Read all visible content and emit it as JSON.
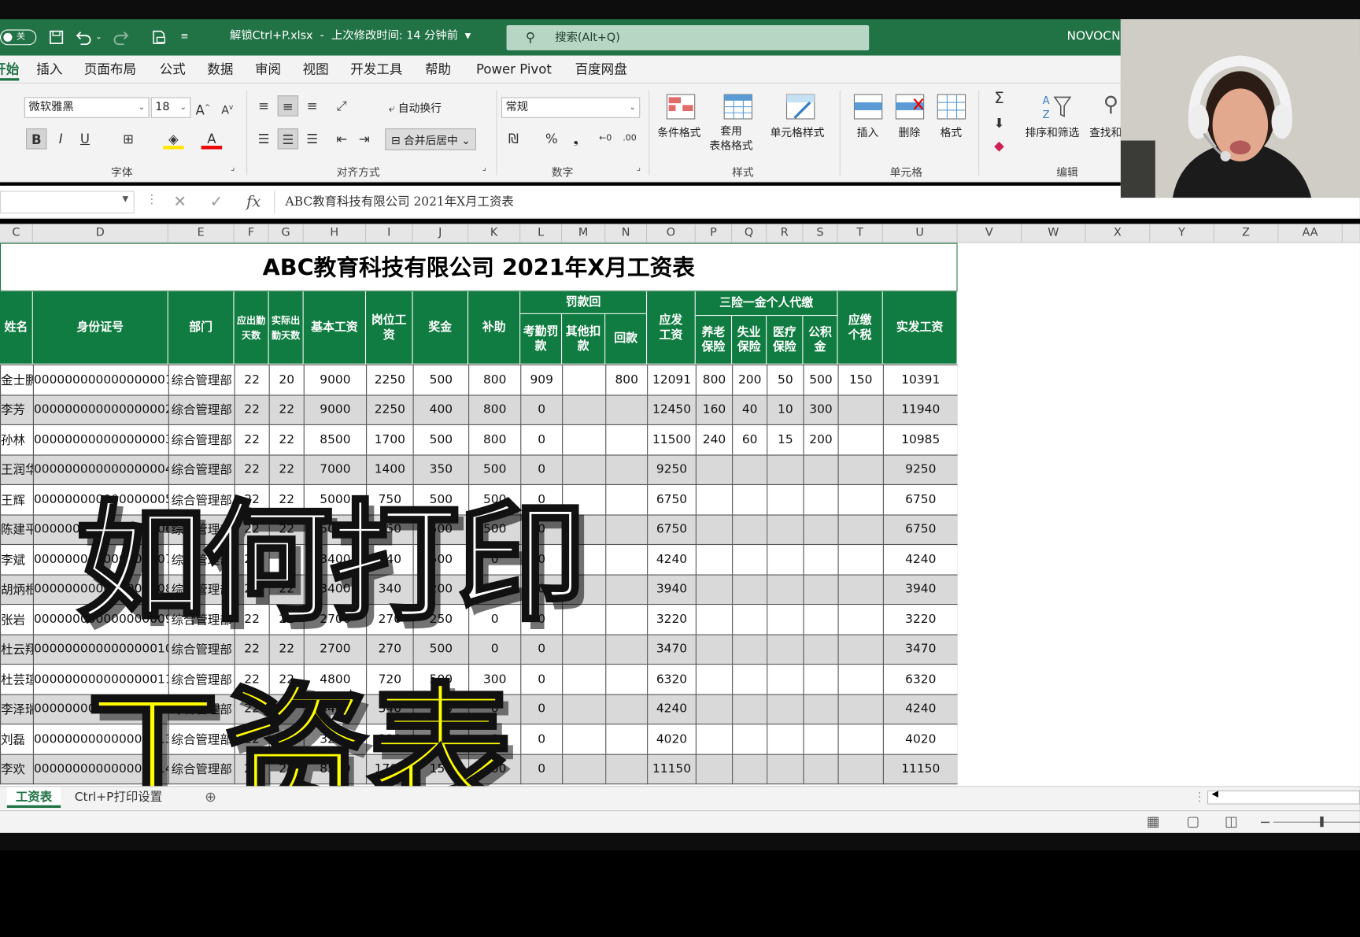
{
  "titlebar": {
    "autosave": "关",
    "filename": "解锁Ctrl+P.xlsx",
    "modified": "上次修改时间: 14 分钟前",
    "search_placeholder": "搜索(Alt+Q)",
    "user": "NOVOCN"
  },
  "menu": [
    "开始",
    "插入",
    "页面布局",
    "公式",
    "数据",
    "审阅",
    "视图",
    "开发工具",
    "帮助",
    "Power Pivot",
    "百度网盘"
  ],
  "ribbon": {
    "font_name": "微软雅黑",
    "font_size": "18",
    "wrap_text": "自动换行",
    "merge_center": "合并后居中",
    "number_format": "常规",
    "cond_format": "条件格式",
    "table_format": "套用\n表格格式",
    "cell_styles": "单元格样式",
    "insert": "插入",
    "delete": "删除",
    "format": "格式",
    "sort_filter": "排序和筛选",
    "find_select": "查找和",
    "groups": {
      "font": "字体",
      "align": "对齐方式",
      "number": "数字",
      "styles": "样式",
      "cells": "单元格",
      "editing": "编辑"
    }
  },
  "formula": {
    "content": "ABC教育科技有限公司     2021年X月工资表"
  },
  "columns": [
    "C",
    "D",
    "E",
    "F",
    "G",
    "H",
    "I",
    "J",
    "K",
    "L",
    "M",
    "N",
    "O",
    "P",
    "Q",
    "R",
    "S",
    "T",
    "U",
    "V",
    "W",
    "X",
    "Y",
    "Z",
    "AA"
  ],
  "sheet": {
    "title": "ABC教育科技有限公司  2021年X月工资表",
    "headers": {
      "name": "姓名",
      "id": "身份证号",
      "dept": "部门",
      "days1": "应出勤天数",
      "days2": "实际出勤天数",
      "base": "基本工资",
      "post": "岗位工资",
      "bonus": "奖金",
      "allowance": "补助",
      "attendance_deduct": "考勤罚款",
      "deduct_group": "罚款回",
      "other_deduct": "其他扣款",
      "refund": "回款",
      "gross": "应发\n工资",
      "insurance_group": "三险一金个人代缴",
      "pension": "养老\n保险",
      "unemployment": "失业\n保险",
      "medical": "医疗\n保险",
      "fund": "公积\n金",
      "tax": "应缴\n个税",
      "net": "实发工资"
    },
    "rows": [
      {
        "name": "金士鹏",
        "id": "000000000000000001",
        "dept": "综合管理部",
        "f": "22",
        "g": "20",
        "h": "9000",
        "i": "2250",
        "j": "500",
        "k": "800",
        "l": "909",
        "m": "",
        "n": "800",
        "o": "12091",
        "p": "800",
        "q": "200",
        "r": "50",
        "s": "500",
        "t": "150",
        "u": "10391"
      },
      {
        "name": "李芳",
        "id": "000000000000000002",
        "dept": "综合管理部",
        "f": "22",
        "g": "22",
        "h": "9000",
        "i": "2250",
        "j": "400",
        "k": "800",
        "l": "0",
        "m": "",
        "n": "",
        "o": "12450",
        "p": "160",
        "q": "40",
        "r": "10",
        "s": "300",
        "t": "",
        "u": "11940"
      },
      {
        "name": "孙林",
        "id": "000000000000000003",
        "dept": "综合管理部",
        "f": "22",
        "g": "22",
        "h": "8500",
        "i": "1700",
        "j": "500",
        "k": "800",
        "l": "0",
        "m": "",
        "n": "",
        "o": "11500",
        "p": "240",
        "q": "60",
        "r": "15",
        "s": "200",
        "t": "",
        "u": "10985"
      },
      {
        "name": "王润华",
        "id": "000000000000000004",
        "dept": "综合管理部",
        "f": "22",
        "g": "22",
        "h": "7000",
        "i": "1400",
        "j": "350",
        "k": "500",
        "l": "0",
        "m": "",
        "n": "",
        "o": "9250",
        "p": "",
        "q": "",
        "r": "",
        "s": "",
        "t": "",
        "u": "9250"
      },
      {
        "name": "王辉",
        "id": "000000000000000005",
        "dept": "综合管理部",
        "f": "22",
        "g": "22",
        "h": "5000",
        "i": "750",
        "j": "500",
        "k": "500",
        "l": "0",
        "m": "",
        "n": "",
        "o": "6750",
        "p": "",
        "q": "",
        "r": "",
        "s": "",
        "t": "",
        "u": "6750"
      },
      {
        "name": "陈建平",
        "id": "000000000000000006",
        "dept": "综合管理部",
        "f": "22",
        "g": "22",
        "h": "5000",
        "i": "750",
        "j": "500",
        "k": "500",
        "l": "0",
        "m": "",
        "n": "",
        "o": "6750",
        "p": "",
        "q": "",
        "r": "",
        "s": "",
        "t": "",
        "u": "6750"
      },
      {
        "name": "李斌",
        "id": "000000000000000007",
        "dept": "综合管理部",
        "f": "22",
        "g": "22",
        "h": "3400",
        "i": "340",
        "j": "500",
        "k": "0",
        "l": "0",
        "m": "",
        "n": "",
        "o": "4240",
        "p": "",
        "q": "",
        "r": "",
        "s": "",
        "t": "",
        "u": "4240"
      },
      {
        "name": "胡炳根",
        "id": "000000000000000008",
        "dept": "综合管理部",
        "f": "22",
        "g": "22",
        "h": "3400",
        "i": "340",
        "j": "200",
        "k": "0",
        "l": "0",
        "m": "",
        "n": "",
        "o": "3940",
        "p": "",
        "q": "",
        "r": "",
        "s": "",
        "t": "",
        "u": "3940"
      },
      {
        "name": "张岩",
        "id": "000000000000000009",
        "dept": "综合管理部",
        "f": "22",
        "g": "22",
        "h": "2700",
        "i": "270",
        "j": "250",
        "k": "0",
        "l": "0",
        "m": "",
        "n": "",
        "o": "3220",
        "p": "",
        "q": "",
        "r": "",
        "s": "",
        "t": "",
        "u": "3220"
      },
      {
        "name": "杜云翔",
        "id": "000000000000000010",
        "dept": "综合管理部",
        "f": "22",
        "g": "22",
        "h": "2700",
        "i": "270",
        "j": "500",
        "k": "0",
        "l": "0",
        "m": "",
        "n": "",
        "o": "3470",
        "p": "",
        "q": "",
        "r": "",
        "s": "",
        "t": "",
        "u": "3470"
      },
      {
        "name": "杜芸瑄",
        "id": "000000000000000011",
        "dept": "综合管理部",
        "f": "22",
        "g": "22",
        "h": "4800",
        "i": "720",
        "j": "500",
        "k": "300",
        "l": "0",
        "m": "",
        "n": "",
        "o": "6320",
        "p": "",
        "q": "",
        "r": "",
        "s": "",
        "t": "",
        "u": "6320"
      },
      {
        "name": "李泽瑞",
        "id": "000000000000000012",
        "dept": "综合管理部",
        "f": "22",
        "g": "22",
        "h": "3400",
        "i": "340",
        "j": "500",
        "k": "0",
        "l": "0",
        "m": "",
        "n": "",
        "o": "4240",
        "p": "",
        "q": "",
        "r": "",
        "s": "",
        "t": "",
        "u": "4240"
      },
      {
        "name": "刘磊",
        "id": "000000000000000013",
        "dept": "综合管理部",
        "f": "22",
        "g": "22",
        "h": "3200",
        "i": "320",
        "j": "500",
        "k": "0",
        "l": "0",
        "m": "",
        "n": "",
        "o": "4020",
        "p": "",
        "q": "",
        "r": "",
        "s": "",
        "t": "",
        "u": "4020"
      },
      {
        "name": "李欢",
        "id": "000000000000000014",
        "dept": "综合管理部",
        "f": "22",
        "g": "22",
        "h": "8500",
        "i": "1700",
        "j": "150",
        "k": "800",
        "l": "0",
        "m": "",
        "n": "",
        "o": "11150",
        "p": "",
        "q": "",
        "r": "",
        "s": "",
        "t": "",
        "u": "11150"
      }
    ]
  },
  "tabs": [
    "工资表",
    "Ctrl+P打印设置"
  ],
  "overlay": {
    "line1": "如何打印",
    "line2": "工资表"
  },
  "colors": {
    "excel_green": "#217346",
    "header_green": "#107c41",
    "overlay_yellow": "#ffff00"
  }
}
